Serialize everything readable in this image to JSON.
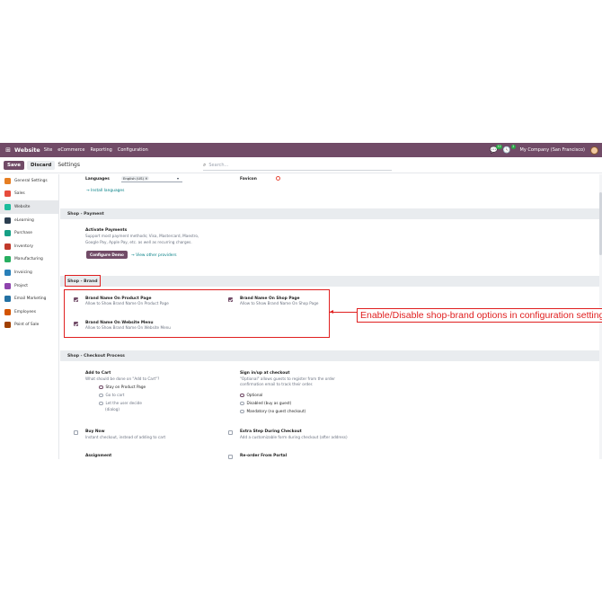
{
  "nav": {
    "app": "Website",
    "menus": [
      "Site",
      "eCommerce",
      "Reporting",
      "Configuration"
    ],
    "badge1": "12",
    "badge2": "2",
    "company": "My Company (San Francisco)"
  },
  "controls": {
    "save": "Save",
    "discard": "Discard",
    "title": "Settings",
    "search_placeholder": "Search..."
  },
  "sidebar": [
    {
      "label": "General Settings",
      "color": "#e67e22"
    },
    {
      "label": "Sales",
      "color": "#e74c3c"
    },
    {
      "label": "Website",
      "color": "#1abc9c"
    },
    {
      "label": "eLearning",
      "color": "#2c3e50"
    },
    {
      "label": "Purchase",
      "color": "#16a085"
    },
    {
      "label": "Inventory",
      "color": "#c0392b"
    },
    {
      "label": "Manufacturing",
      "color": "#27ae60"
    },
    {
      "label": "Invoicing",
      "color": "#2980b9"
    },
    {
      "label": "Project",
      "color": "#8e44ad"
    },
    {
      "label": "Email Marketing",
      "color": "#2471a3"
    },
    {
      "label": "Employees",
      "color": "#d35400"
    },
    {
      "label": "Point of Sale",
      "color": "#a04000"
    }
  ],
  "top": {
    "languages_label": "Languages",
    "language_tag": "English (US)",
    "install_languages": "→ Install languages",
    "favicon_label": "Favicon"
  },
  "payment": {
    "header": "Shop - Payment",
    "title": "Activate Payments",
    "desc1": "Support most payment methods; Visa, Mastercard, Maestro,",
    "desc2": "Google Pay, Apple Pay, etc. as well as recurring charges.",
    "configure": "Configure Demo",
    "view_other": "→ View other providers"
  },
  "brand": {
    "header": "Shop - Brand",
    "opt1_title": "Brand Name On Product Page",
    "opt1_desc": "Allow to Show Brand Name On Product Page",
    "opt2_title": "Brand Name On Shop Page",
    "opt2_desc": "Allow to Show Brand Name On Shop Page",
    "opt3_title": "Brand Name On Website Menu",
    "opt3_desc": "Allow to Show Brand Name On Website Menu"
  },
  "checkout": {
    "header": "Shop - Checkout Process",
    "add_title": "Add to Cart",
    "add_desc": "What should be done on \"Add to Cart\"?",
    "r1": "Stay on Product Page",
    "r2": "Go to cart",
    "r3a": "Let the user decide",
    "r3b": "(dialog)",
    "sign_title": "Sign in/up at checkout",
    "sign_desc1": "\"Optional\" allows guests to register from the order",
    "sign_desc2": "confirmation email to track their order.",
    "s1": "Optional",
    "s2": "Disabled (buy as guest)",
    "s3": "Mandatory (no guest checkout)",
    "buy_title": "Buy Now",
    "buy_desc": "Instant checkout, instead of adding to cart",
    "extra_title": "Extra Step During Checkout",
    "extra_desc": "Add a customizable form during checkout (after address)",
    "assign_title": "Assignment",
    "reorder_title": "Re-order From Portal"
  },
  "annotation": "Enable/Disable shop-brand options in configuration settings."
}
